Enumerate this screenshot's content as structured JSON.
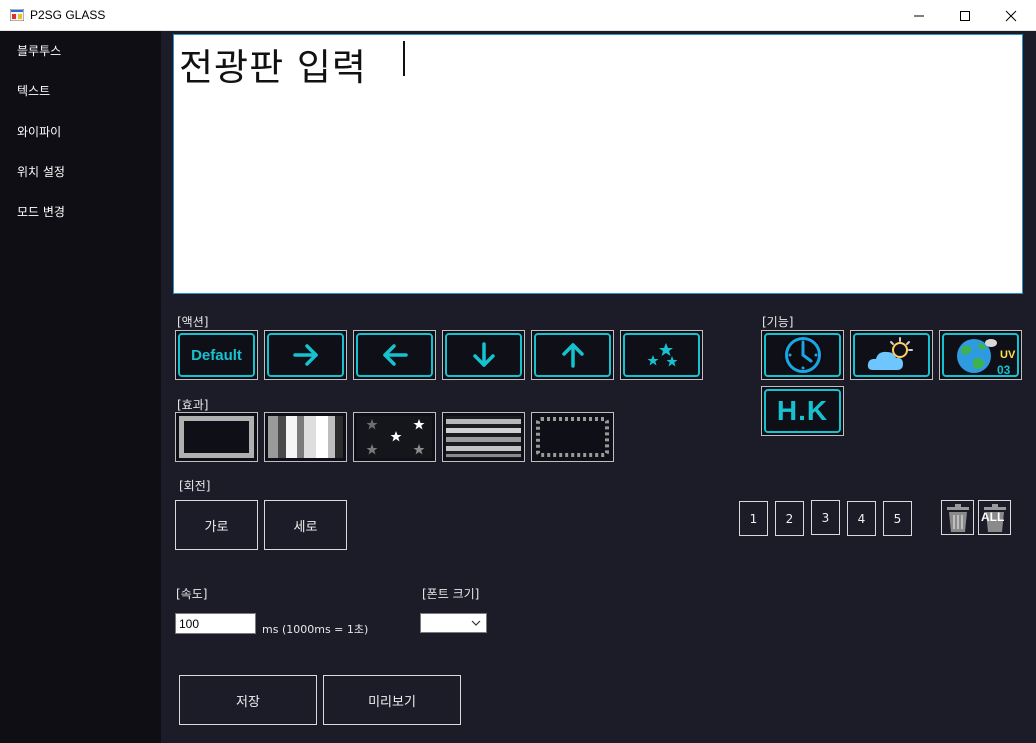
{
  "window": {
    "title": "P2SG GLASS"
  },
  "sidebar": {
    "items": [
      {
        "label": "블루투스"
      },
      {
        "label": "텍스트"
      },
      {
        "label": "와이파이"
      },
      {
        "label": "위치 설정"
      },
      {
        "label": "모드 변경"
      }
    ]
  },
  "editor": {
    "text": "전광판 입력"
  },
  "actions": {
    "label": "[액션]",
    "default_label": "Default",
    "buttons": [
      "default",
      "arrow-right",
      "arrow-left",
      "arrow-down",
      "arrow-up",
      "sparkle-stars"
    ]
  },
  "functions": {
    "label": "[기능]",
    "hk_label": "H.K",
    "uv_label": "UV",
    "uv_value": "03",
    "buttons": [
      "clock",
      "weather",
      "uv-index",
      "hk"
    ]
  },
  "effects": {
    "label": "[효과]",
    "buttons": [
      "frame",
      "vertical-stripes",
      "stars",
      "horizontal-stripes",
      "dotted-border"
    ]
  },
  "rotation": {
    "label": "[회전]",
    "horizontal_label": "가로",
    "vertical_label": "세로"
  },
  "slots": [
    "1",
    "2",
    "3",
    "4",
    "5"
  ],
  "delete_all_label": "ALL",
  "speed": {
    "label": "[속도]",
    "value": "100",
    "unit_text": "ms (1000ms = 1초)"
  },
  "font_size": {
    "label": "[폰트 크기]",
    "value": ""
  },
  "buttons": {
    "save_label": "저장",
    "preview_label": "미리보기"
  },
  "colors": {
    "accent": "#16c2cf",
    "background": "#1c1c28",
    "sidebar": "#0e0e14"
  }
}
